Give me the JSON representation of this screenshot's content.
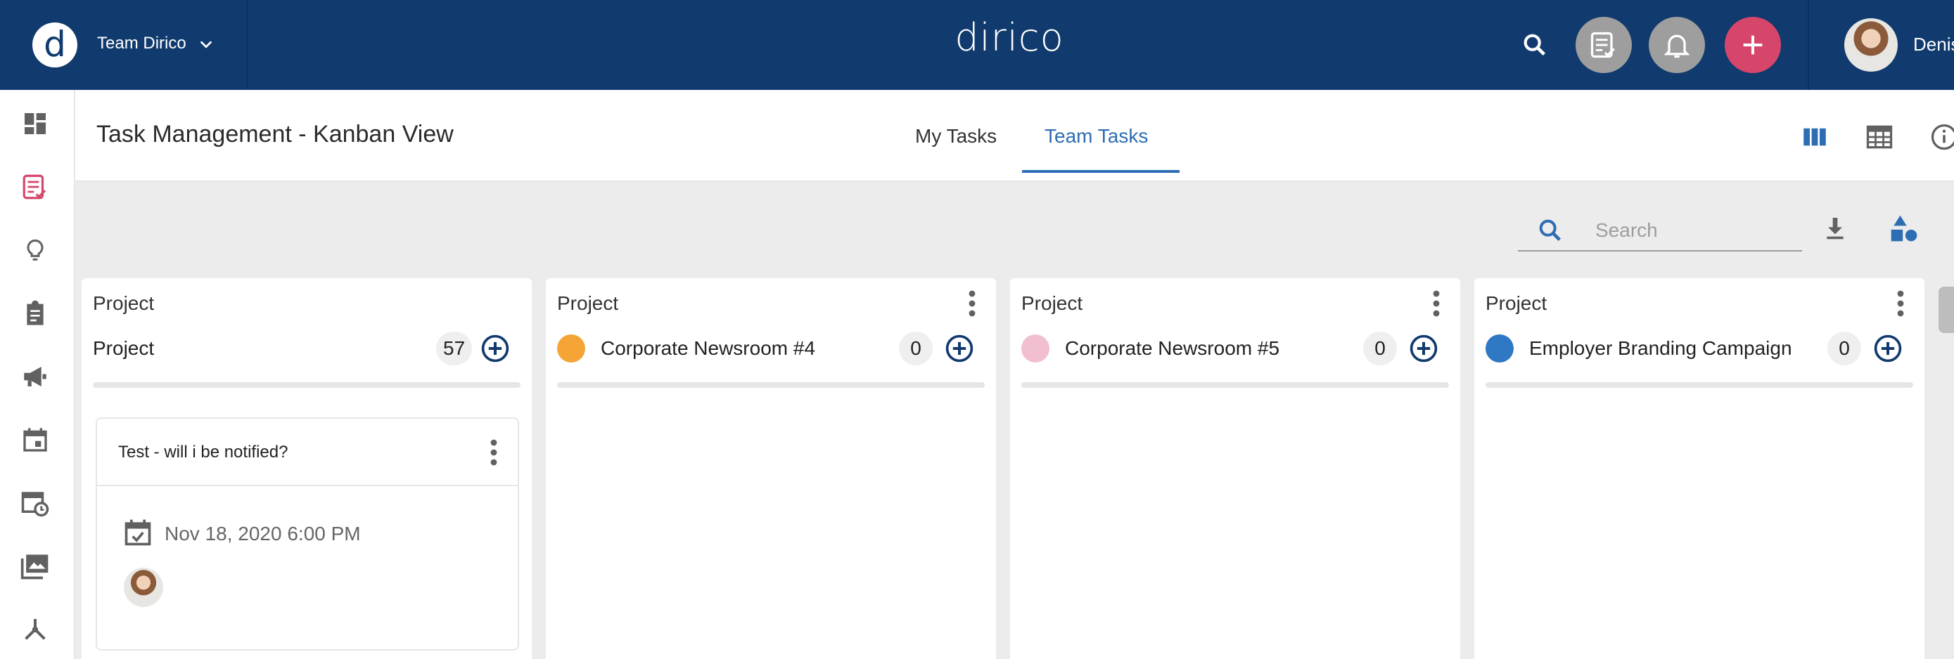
{
  "header": {
    "logo_letter": "d",
    "team_name": "Team Dirico",
    "app_title": "dirico",
    "user_name": "Denis",
    "icons": [
      "search-icon",
      "task-list-icon",
      "bell-icon",
      "plus-icon"
    ]
  },
  "sidebar": {
    "items": [
      {
        "icon": "dashboard-icon",
        "active": false
      },
      {
        "icon": "task-list-icon",
        "active": true
      },
      {
        "icon": "lightbulb-icon",
        "active": false
      },
      {
        "icon": "clipboard-icon",
        "active": false
      },
      {
        "icon": "megaphone-icon",
        "active": false
      },
      {
        "icon": "calendar-icon",
        "active": false
      },
      {
        "icon": "calendar-clock-icon",
        "active": false
      },
      {
        "icon": "media-library-icon",
        "active": false
      },
      {
        "icon": "network-icon",
        "active": false
      }
    ]
  },
  "page": {
    "title": "Task Management - Kanban View",
    "tabs": [
      {
        "label": "My Tasks",
        "active": false
      },
      {
        "label": "Team Tasks",
        "active": true
      }
    ],
    "view_icons": [
      "kanban-view-icon",
      "table-view-icon",
      "info-icon"
    ]
  },
  "toolbar": {
    "search_placeholder": "Search",
    "icons": [
      "download-icon",
      "shapes-filter-icon"
    ]
  },
  "columns": [
    {
      "type_label": "Project",
      "name": "Project",
      "count": "57",
      "dot_color": null
    },
    {
      "type_label": "Project",
      "name": "Corporate Newsroom #4",
      "count": "0",
      "dot_color": "#f4a535"
    },
    {
      "type_label": "Project",
      "name": "Corporate Newsroom #5",
      "count": "0",
      "dot_color": "#f2bfd1"
    },
    {
      "type_label": "Project",
      "name": "Employer Branding Campaign",
      "count": "0",
      "dot_color": "#2f78c4"
    }
  ],
  "task": {
    "title": "Test - will i be notified?",
    "due_date": "Nov 18, 2020 6:00 PM"
  },
  "colors": {
    "brand_blue": "#113a6e",
    "accent_blue": "#2d6db4",
    "add_pink": "#d6456a"
  }
}
